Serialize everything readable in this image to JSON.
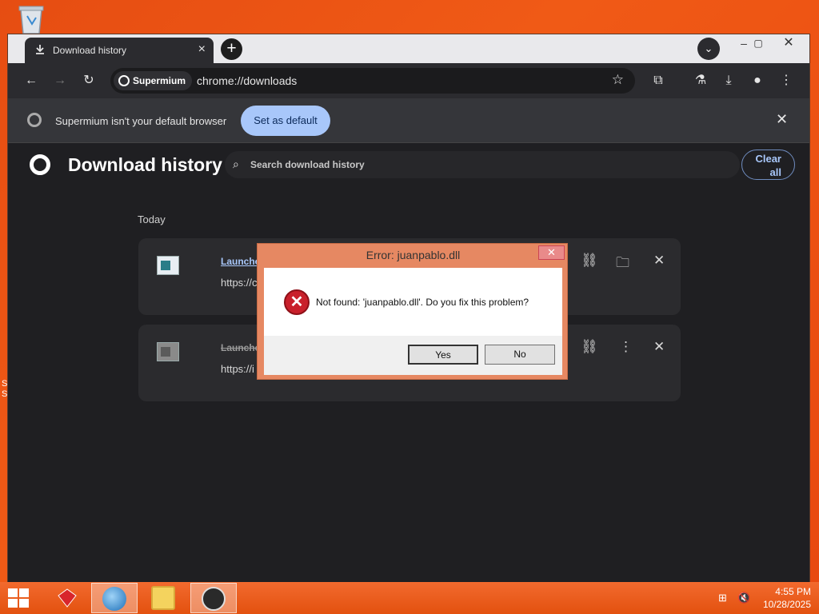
{
  "desktop": {
    "side_text": [
      "S",
      "S"
    ]
  },
  "browser": {
    "tab_title": "Download history",
    "address": {
      "chip_label": "Supermium",
      "url": "chrome://downloads"
    },
    "infobar": {
      "message": "Supermium isn't your default browser",
      "button_label": "Set as default"
    },
    "page": {
      "title": "Download history",
      "search_placeholder": "Search download history",
      "clear_all_label": "Clear all",
      "section_label": "Today",
      "downloads": [
        {
          "name": "Launche",
          "url": "https://c",
          "status": "active"
        },
        {
          "name": "Launche",
          "url": "https://i",
          "status": "removed"
        }
      ]
    }
  },
  "dialog": {
    "title": "Error: juanpablo.dll",
    "message": "Not found: 'juanpablo.dll'. Do you fix this problem?",
    "yes_label": "Yes",
    "no_label": "No"
  },
  "taskbar": {
    "time": "4:55 PM",
    "date": "10/28/2025"
  },
  "colors": {
    "desktop_bg": "#e64d12",
    "accent_blue": "#a8c7fa",
    "error_red": "#c9202b",
    "dialog_frame": "#e68862"
  }
}
